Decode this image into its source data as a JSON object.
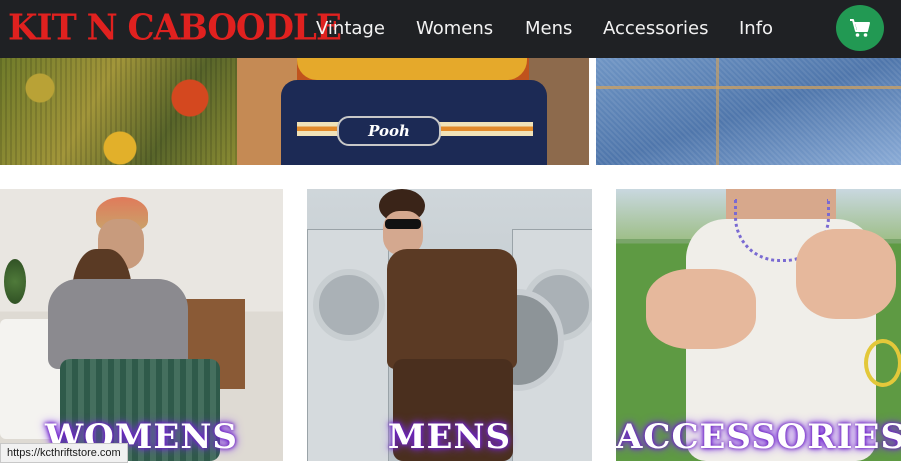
{
  "brand": {
    "logo_text": "Kit N Caboodle"
  },
  "nav": {
    "items": [
      {
        "label": "Vintage"
      },
      {
        "label": "Womens"
      },
      {
        "label": "Mens"
      },
      {
        "label": "Accessories"
      },
      {
        "label": "Info"
      }
    ],
    "cart_icon": "shopping-cart-icon"
  },
  "hero": {
    "panels": [
      {
        "subject": "woven-textile"
      },
      {
        "subject": "pooh-backpack",
        "badge_text": "Pooh"
      },
      {
        "subject": "denim-overalls"
      }
    ]
  },
  "categories": [
    {
      "label": "WOMENS"
    },
    {
      "label": "MENS"
    },
    {
      "label": "ACCESSORIES"
    }
  ],
  "status_bar": {
    "url": "https://kcthriftstore.com"
  },
  "colors": {
    "nav_bg": "#1f2124",
    "logo": "#e0211f",
    "cart_bg": "#229953",
    "label_glow": "#6a1fbf"
  }
}
